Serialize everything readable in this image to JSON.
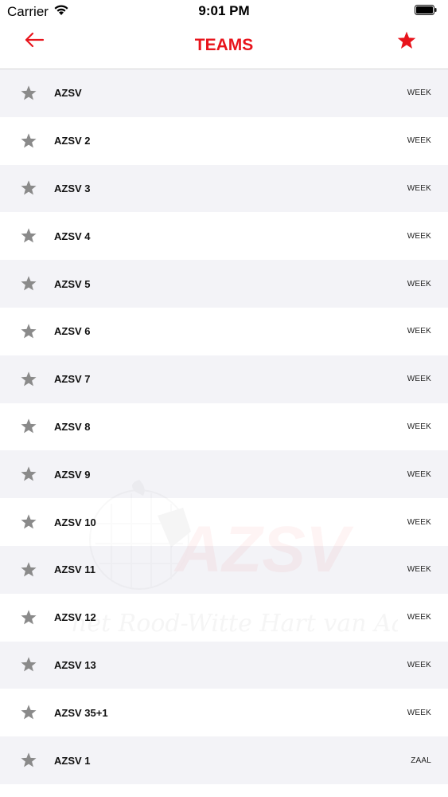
{
  "status_bar": {
    "carrier": "Carrier",
    "time": "9:01 PM"
  },
  "nav": {
    "title": "TEAMS",
    "back_icon": "arrow-left-icon",
    "favorites_icon": "star-icon",
    "accent_color": "#e8141c"
  },
  "watermark": {
    "logo_text": "AZSV",
    "slogan": "het Rood-Witte Hart van Aalten"
  },
  "teams": [
    {
      "name": "AZSV",
      "type": "WEEK"
    },
    {
      "name": "AZSV 2",
      "type": "WEEK"
    },
    {
      "name": "AZSV 3",
      "type": "WEEK"
    },
    {
      "name": "AZSV 4",
      "type": "WEEK"
    },
    {
      "name": "AZSV 5",
      "type": "WEEK"
    },
    {
      "name": "AZSV 6",
      "type": "WEEK"
    },
    {
      "name": "AZSV 7",
      "type": "WEEK"
    },
    {
      "name": "AZSV 8",
      "type": "WEEK"
    },
    {
      "name": "AZSV 9",
      "type": "WEEK"
    },
    {
      "name": "AZSV 10",
      "type": "WEEK"
    },
    {
      "name": "AZSV 11",
      "type": "WEEK"
    },
    {
      "name": "AZSV 12",
      "type": "WEEK"
    },
    {
      "name": "AZSV 13",
      "type": "WEEK"
    },
    {
      "name": "AZSV 35+1",
      "type": "WEEK"
    },
    {
      "name": "AZSV 1",
      "type": "ZAAL"
    }
  ]
}
